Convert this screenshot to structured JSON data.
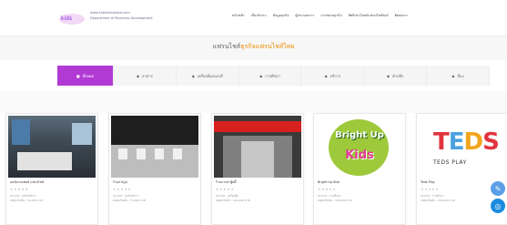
{
  "header": {
    "logo_text_line1": "www.kidsmilephoto.com",
    "logo_text_line2": "Department of Business Development",
    "nav": [
      "หน้าหลัก",
      "เกี่ยวกับเรา",
      "ข้อมูลธุรกิจ",
      "ผู้ประกอบการ",
      "การขยายธุรกิจ",
      "สิทธิประโยชน์แฟรนไชส์ซอร์",
      "ติดต่อเรา"
    ]
  },
  "hero": {
    "title_prefix": "แฟรนไชส์",
    "title_highlight": "ธุรกิจแฟรนไชส์ไทย"
  },
  "tabs": [
    {
      "label": "ทั้งหมด",
      "icon": "grid-icon",
      "active": true
    },
    {
      "label": "อาหาร",
      "icon": "food-icon",
      "active": false
    },
    {
      "label": "เครื่องดื่มเบเกอรี่",
      "icon": "drink-icon",
      "active": false
    },
    {
      "label": "การศึกษา",
      "icon": "book-icon",
      "active": false
    },
    {
      "label": "บริการ",
      "icon": "service-icon",
      "active": false
    },
    {
      "label": "ค้าปลีก",
      "icon": "shop-icon",
      "active": false
    },
    {
      "label": "อื่นๆ",
      "icon": "more-icon",
      "active": false
    }
  ],
  "cards": [
    {
      "caption": "บอร์ดเกมเพลย์ แฟรนไชส์",
      "stars": "★★★★★",
      "meta1": "ประเภท : ธุรกิจบริการ",
      "meta2": "ลงทุนเริ่มต้น : 50,000 บาท"
    },
    {
      "caption": "ร้านถ่ายรูป",
      "stars": "★★★★★",
      "meta1": "ประเภท : ธุรกิจบริการ",
      "meta2": "ลงทุนเริ่มต้น : 75,000 บาท"
    },
    {
      "caption": "ร้านกาแฟ ฟู้ดดี้",
      "stars": "★★★★★",
      "meta1": "ประเภท : เครื่องดื่ม",
      "meta2": "ลงทุนเริ่มต้น : 120,000 บาท"
    },
    {
      "caption": "Bright Up Kids",
      "stars": "★★★★★",
      "meta1": "ประเภท : การศึกษา",
      "meta2": "ลงทุนเริ่มต้น : 300,000 บาท",
      "logo_text_1": "Bright Up",
      "logo_text_2": "Kids"
    },
    {
      "caption": "Teds Play",
      "stars": "★★★★★",
      "meta1": "ประเภท : การศึกษา",
      "meta2": "ลงทุนเริ่มต้น : 250,000 บาท",
      "logo_text_1": "TEDS",
      "logo_text_2": "TEDS PLAY"
    }
  ],
  "fab": {
    "chat_icon": "chat-icon",
    "messenger_icon": "messenger-icon"
  }
}
